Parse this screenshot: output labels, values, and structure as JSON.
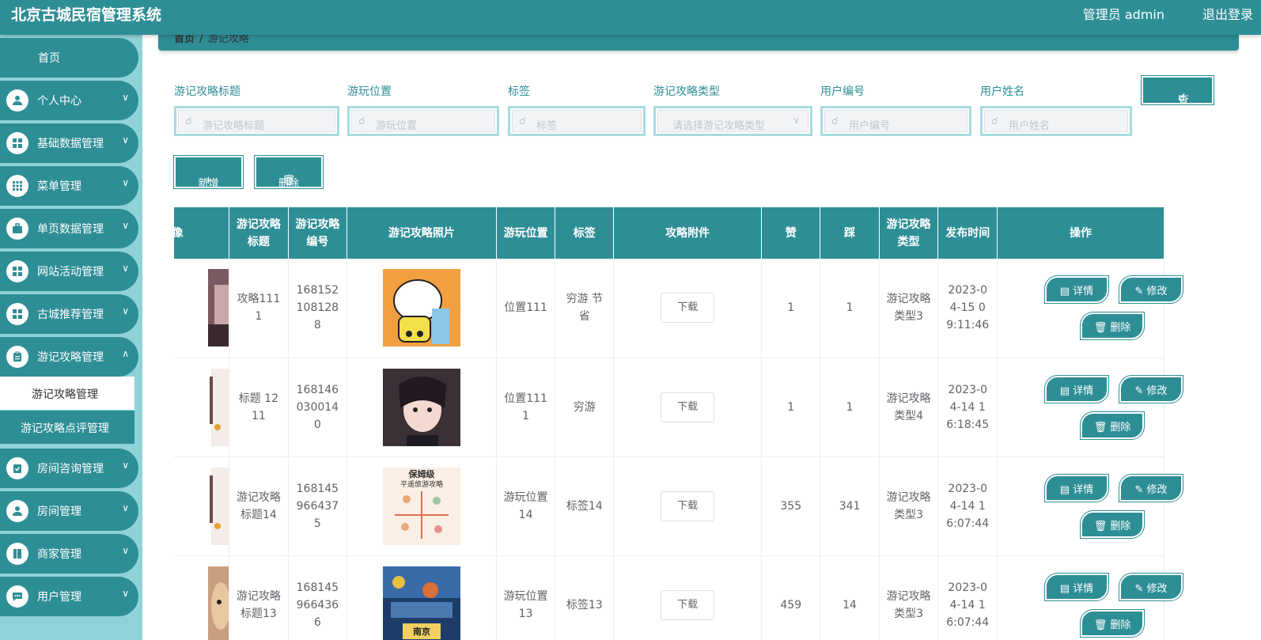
{
  "header": {
    "title": "北京古城民宿管理系统",
    "admin": "管理员 admin",
    "logout": "退出登录"
  },
  "sidebar": {
    "home": "首页",
    "items": [
      {
        "label": "个人中心",
        "icon": "user-icon"
      },
      {
        "label": "基础数据管理",
        "icon": "grid-icon"
      },
      {
        "label": "菜单管理",
        "icon": "apps-icon"
      },
      {
        "label": "单页数据管理",
        "icon": "briefcase-icon"
      },
      {
        "label": "网站活动管理",
        "icon": "grid-icon"
      },
      {
        "label": "古城推荐管理",
        "icon": "grid-icon"
      },
      {
        "label": "游记攻略管理",
        "icon": "clipboard-icon"
      },
      {
        "label": "房间咨询管理",
        "icon": "checklist-icon"
      },
      {
        "label": "房间管理",
        "icon": "user-icon"
      },
      {
        "label": "商家管理",
        "icon": "book-icon"
      },
      {
        "label": "用户管理",
        "icon": "chat-icon"
      }
    ],
    "submenu": [
      "游记攻略管理",
      "游记攻略点评管理"
    ]
  },
  "breadcrumb": {
    "home": "首页",
    "separator": "/",
    "current": "游记攻略"
  },
  "search": {
    "fields": [
      {
        "label": "游记攻略标题",
        "placeholder": "游记攻略标题"
      },
      {
        "label": "游玩位置",
        "placeholder": "游玩位置"
      },
      {
        "label": "标签",
        "placeholder": "标签"
      },
      {
        "label": "游记攻略类型",
        "placeholder": "请选择游记攻略类型"
      },
      {
        "label": "用户编号",
        "placeholder": "用户编号"
      },
      {
        "label": "用户姓名",
        "placeholder": "用户姓名"
      }
    ],
    "query_button": "查询"
  },
  "toolbar": {
    "add": "新增",
    "delete": "删除"
  },
  "table": {
    "headers": [
      "头像",
      "游记攻略标题",
      "游记攻略编号",
      "游记攻略照片",
      "游玩位置",
      "标签",
      "攻略附件",
      "赞",
      "踩",
      "游记攻略类型",
      "发布时间",
      "操作"
    ],
    "download_label": "下载",
    "detail_label": "详情",
    "edit_label": "修改",
    "delete_label": "删除",
    "rows": [
      {
        "title": "攻略1111",
        "code": "1681521081288",
        "location": "位置111",
        "tag": "穷游 节省",
        "likes": "1",
        "dislikes": "1",
        "type": "游记攻略类型3",
        "time": "2023-04-15 09:11:46"
      },
      {
        "title": "标题 1211",
        "code": "1681460300140",
        "location": "位置1111",
        "tag": "穷游",
        "likes": "1",
        "dislikes": "1",
        "type": "游记攻略类型4",
        "time": "2023-04-14 16:18:45"
      },
      {
        "title": "游记攻略标题14",
        "code": "1681459664375",
        "location": "游玩位置14",
        "tag": "标签14",
        "likes": "355",
        "dislikes": "341",
        "type": "游记攻略类型3",
        "time": "2023-04-14 16:07:44"
      },
      {
        "title": "游记攻略标题13",
        "code": "1681459664366",
        "location": "游玩位置13",
        "tag": "标签13",
        "likes": "459",
        "dislikes": "14",
        "type": "游记攻略类型3",
        "time": "2023-04-14 16:07:44"
      }
    ],
    "photo3_text": [
      "保姆级",
      "平遥旅游攻略"
    ],
    "photo4_text": "南京"
  },
  "colors": {
    "primary": "#2e8e96",
    "sidebar_bg": "#8fd2d8",
    "input_border": "#a8dbe0"
  }
}
